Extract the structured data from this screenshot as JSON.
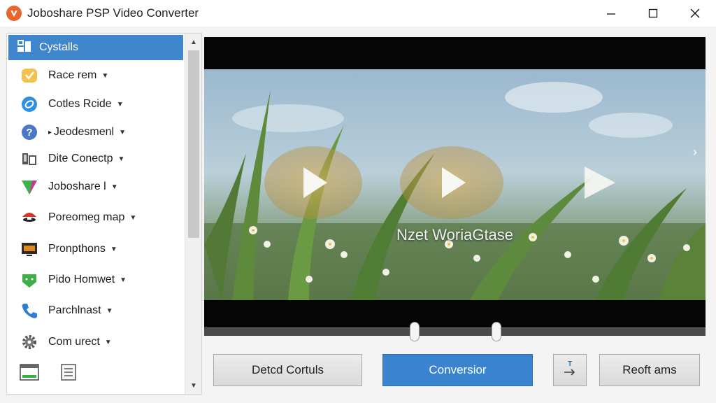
{
  "window": {
    "title": "Joboshare PSP Video Converter",
    "accent": "#3f86cd",
    "icon": "app-logo-icon"
  },
  "sidebar": {
    "header": {
      "label": "Cystalls",
      "icon": "category-icon"
    },
    "items": [
      {
        "label": "Race rem",
        "icon": "heart-badge-icon",
        "prefix": ""
      },
      {
        "label": "Cotles Rcide",
        "icon": "globe-icon",
        "prefix": ""
      },
      {
        "label": "Jeodesmenl",
        "icon": "help-icon",
        "prefix": "▸ "
      },
      {
        "label": "Dite Conectp",
        "icon": "device-icon",
        "prefix": ""
      },
      {
        "label": "Joboshare l",
        "icon": "joboshare-logo-icon",
        "prefix": ""
      },
      {
        "label": "Poreomeg map",
        "icon": "mushroom-icon",
        "prefix": ""
      },
      {
        "label": "Pronpthons",
        "icon": "monitor-icon",
        "prefix": ""
      },
      {
        "label": "Pido Homwet",
        "icon": "android-icon",
        "prefix": ""
      },
      {
        "label": "Parchlnast",
        "icon": "phone-icon",
        "prefix": ""
      },
      {
        "label": "Com urect",
        "icon": "gear-icon",
        "prefix": ""
      }
    ],
    "bottom_icons": [
      "list-panel-icon",
      "document-icon"
    ]
  },
  "preview": {
    "caption": "Nzet WoriaGtase",
    "play_buttons": 3,
    "seek_positions": [
      0.42,
      0.58
    ]
  },
  "actions": {
    "detect_label": "Detcd Cortuls",
    "convert_label": "Conversior",
    "swap_icon": "swap-arrow-icon",
    "settings_label": "Reoft ams"
  }
}
